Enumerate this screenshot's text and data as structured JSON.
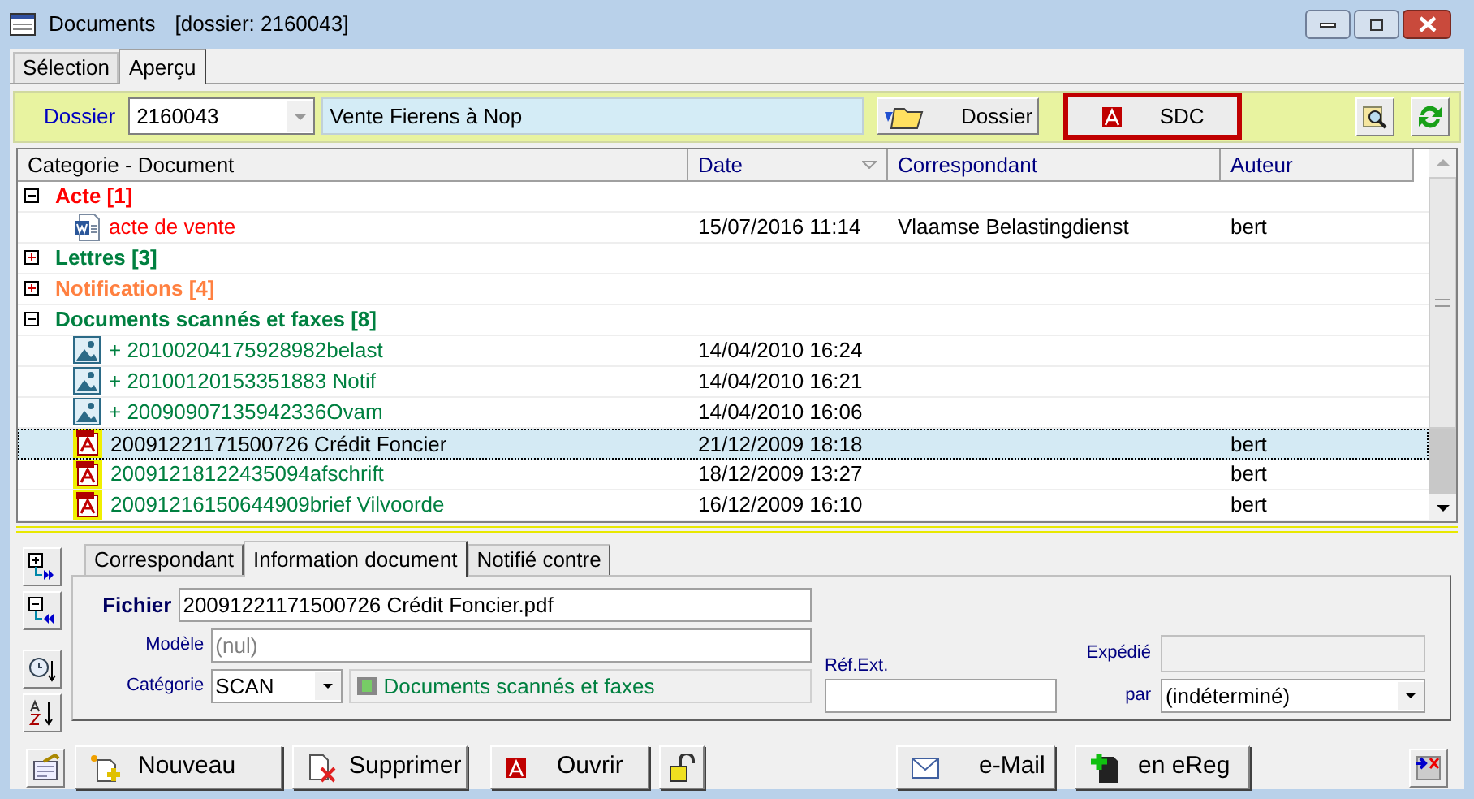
{
  "window": {
    "title": "Documents",
    "subtitle": "[dossier: 2160043]"
  },
  "tabs": [
    {
      "label": "Sélection",
      "selected": false
    },
    {
      "label": "Aperçu",
      "selected": true
    }
  ],
  "toolbar": {
    "dossier_label": "Dossier",
    "dossier_number": "2160043",
    "dossier_name": "Vente Fierens à Nop",
    "buttons": [
      {
        "label": "Dossier",
        "kind": "folder",
        "highlighted": false
      },
      {
        "label": "SDC",
        "kind": "pdf",
        "highlighted": true
      }
    ]
  },
  "table": {
    "columns": [
      {
        "label": "Categorie - Document",
        "sorted": false
      },
      {
        "label": "Date",
        "sorted": true
      },
      {
        "label": "Correspondant",
        "sorted": false
      },
      {
        "label": "Auteur",
        "sorted": false
      }
    ],
    "groups": [
      {
        "label": "Acte [1]",
        "color": "#ff0000",
        "expanded": true,
        "children": [
          {
            "name": "acte de vente",
            "kind": "word",
            "date": "15/07/2016 11:14",
            "correspondant": "Vlaamse Belastingdienst",
            "auteur": "bert",
            "selected": false
          }
        ]
      },
      {
        "label": "Lettres [3]",
        "color": "#008040",
        "expanded": false
      },
      {
        "label": "Notifications [4]",
        "color": "#ff8040",
        "expanded": false
      },
      {
        "label": "Documents scannés et faxes [8]",
        "color": "#008040",
        "expanded": true,
        "children": [
          {
            "name": "+ 20100204175928982belast",
            "kind": "image",
            "date": "14/04/2010 16:24",
            "selected": false
          },
          {
            "name": "+ 20100120153351883 Notif",
            "kind": "image",
            "date": "14/04/2010 16:21",
            "selected": false
          },
          {
            "name": "+ 20090907135942336Ovam",
            "kind": "image",
            "date": "14/04/2010 16:06",
            "selected": false
          },
          {
            "name": "20091221171500726 Crédit Foncier",
            "kind": "pdf",
            "date": "21/12/2009 18:18",
            "auteur": "bert",
            "selected": true
          },
          {
            "name": "20091218122435094afschrift",
            "kind": "pdf",
            "date": "18/12/2009 13:27",
            "auteur": "bert",
            "selected": false
          },
          {
            "name": "20091216150644909brief Vilvoorde",
            "kind": "pdf",
            "date": "16/12/2009 16:10",
            "auteur": "bert",
            "selected": false
          }
        ]
      }
    ]
  },
  "detail_tabs": [
    {
      "label": "Correspondant",
      "selected": false
    },
    {
      "label": "Information document",
      "selected": true
    },
    {
      "label": "Notifié contre",
      "selected": false
    }
  ],
  "form": {
    "fichier_label": "Fichier",
    "fichier": "20091221171500726 Crédit Foncier.pdf",
    "modele_label": "Modèle",
    "modele": "(nul)",
    "categorie_label": "Catégorie",
    "categorie": "SCAN",
    "categorie_name": "Documents scannés et faxes",
    "ref_label": "Réf.Ext.",
    "expedie_label": "Expédié",
    "par_label": "par",
    "par": "(indéterminé)"
  },
  "buttons": [
    {
      "label": "Nouveau",
      "kind": "new"
    },
    {
      "label": "Supprimer",
      "kind": "delete"
    },
    {
      "label": "Ouvrir",
      "kind": "pdf"
    },
    {
      "kind": "lock"
    },
    {
      "label": "e-Mail",
      "kind": "mail"
    },
    {
      "label": "en eReg",
      "kind": "ereg"
    }
  ]
}
